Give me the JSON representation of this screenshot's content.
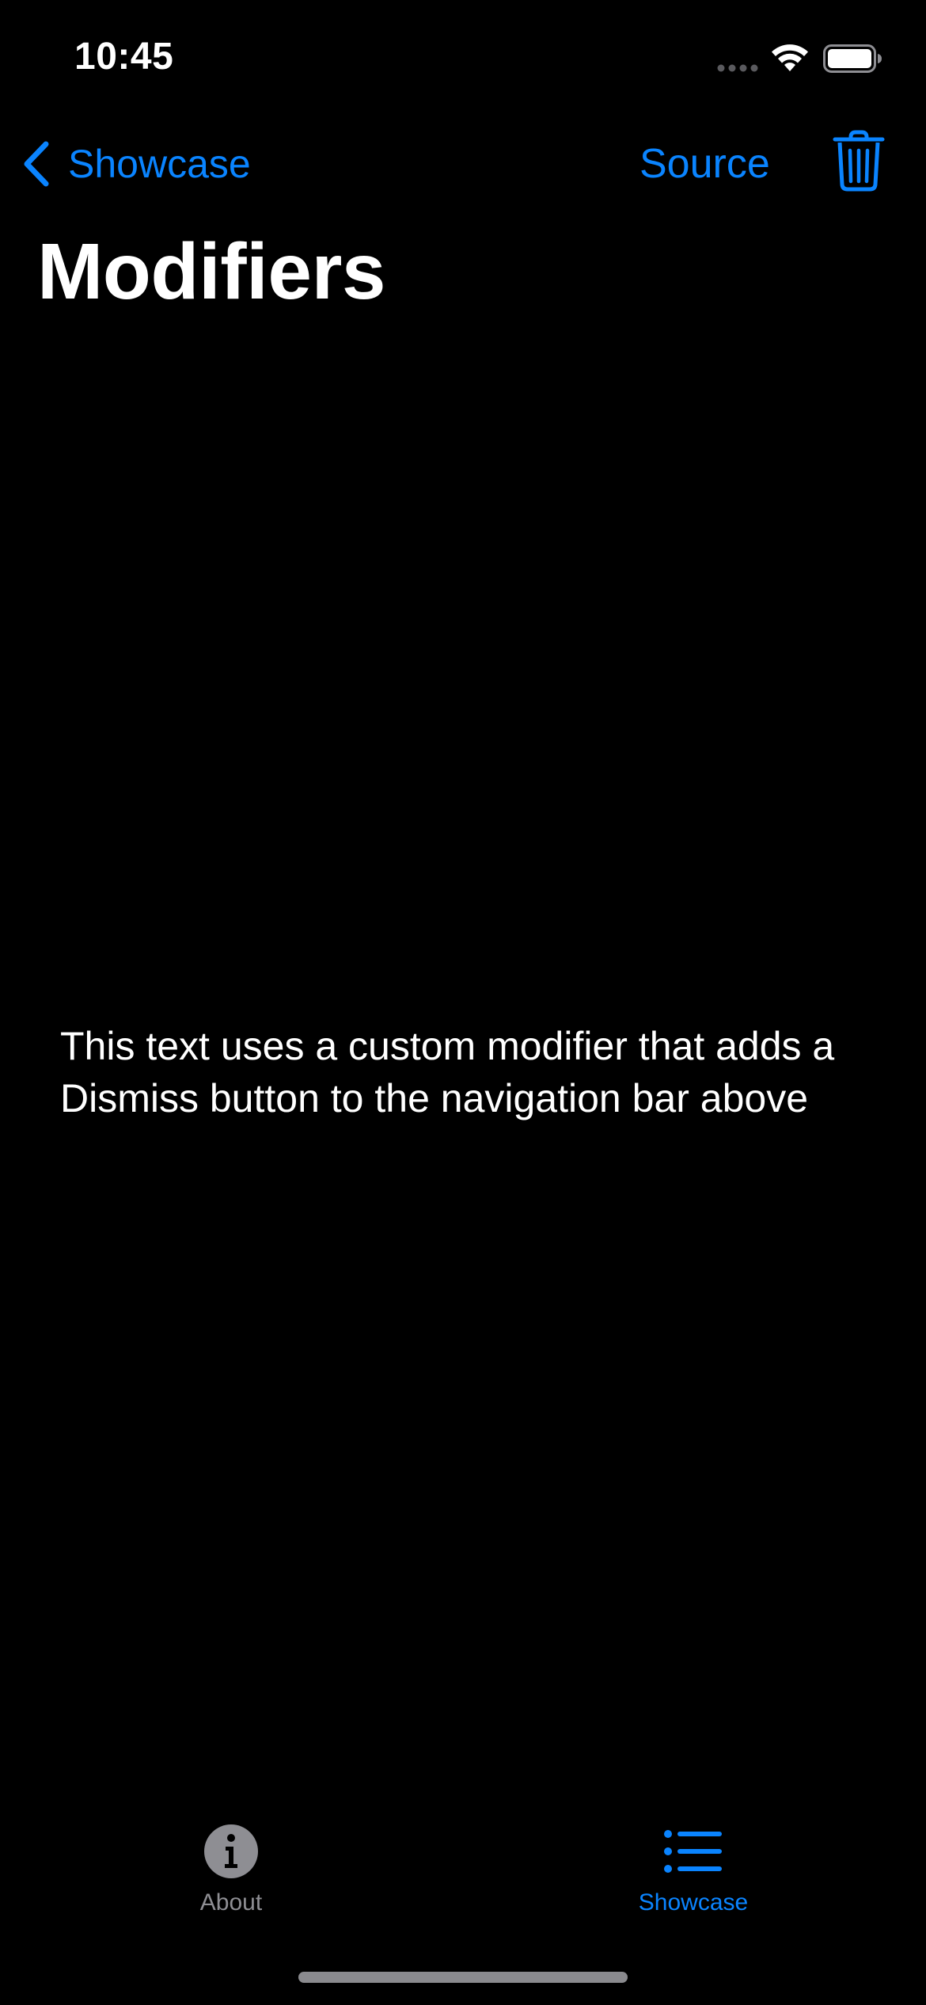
{
  "status_bar": {
    "time": "10:45",
    "signal_icon": "signal-dots-icon",
    "wifi_icon": "wifi-icon",
    "battery_icon": "battery-full-icon"
  },
  "nav": {
    "back_label": "Showcase",
    "back_icon": "chevron-left-icon",
    "source_label": "Source",
    "trash_icon": "trash-icon"
  },
  "page": {
    "title": "Modifiers",
    "body_text": "This text uses a custom modifier that adds a Dismiss button to the navigation bar above"
  },
  "tab_bar": {
    "tabs": [
      {
        "label": "About",
        "icon": "info-circle-icon",
        "selected": false
      },
      {
        "label": "Showcase",
        "icon": "list-bullet-icon",
        "selected": true
      }
    ]
  },
  "colors": {
    "background": "#000000",
    "accent": "#0a84ff",
    "text": "#ffffff",
    "inactive_tab": "#8e8e93"
  }
}
